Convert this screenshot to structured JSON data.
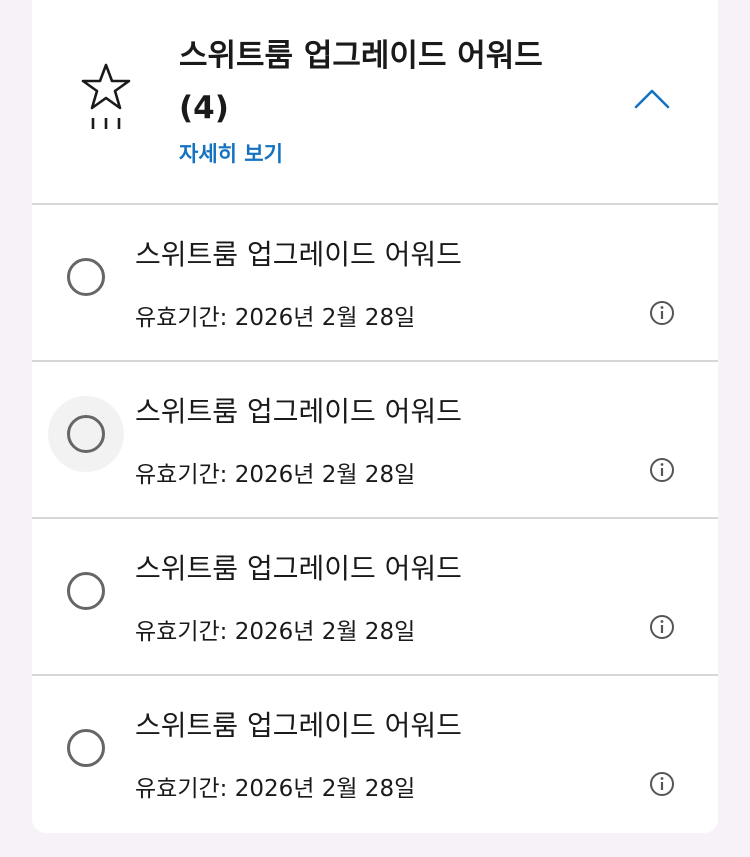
{
  "header": {
    "title": "스위트룸 업그레이드 어워드 (4)",
    "details_label": "자세히 보기",
    "icon": "star-icon",
    "toggle_icon": "chevron-up-icon"
  },
  "awards": [
    {
      "title": "스위트룸 업그레이드 어워드",
      "validity": "유효기간: 2026년 2월 28일"
    },
    {
      "title": "스위트룸 업그레이드 어워드",
      "validity": "유효기간: 2026년 2월 28일"
    },
    {
      "title": "스위트룸 업그레이드 어워드",
      "validity": "유효기간: 2026년 2월 28일"
    },
    {
      "title": "스위트룸 업그레이드 어워드",
      "validity": "유효기간: 2026년 2월 28일"
    }
  ],
  "colors": {
    "link": "#1472c0",
    "divider": "#d6d6d6",
    "background": "#f7f2f7"
  }
}
